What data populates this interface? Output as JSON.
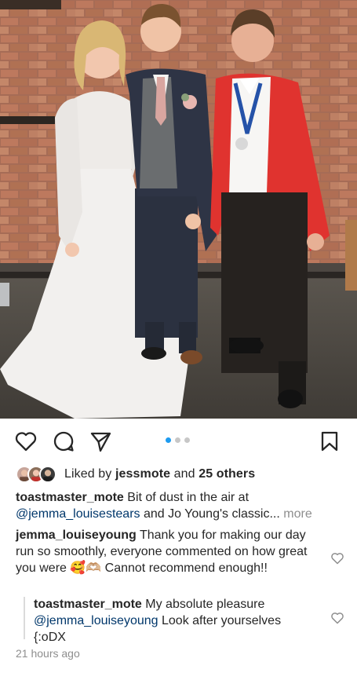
{
  "post": {
    "photo_icon": "wedding-photo",
    "carousel_total": 3,
    "carousel_active": 1
  },
  "actions": {
    "like_icon": "heart-icon",
    "comment_icon": "comment-bubble-icon",
    "share_icon": "paper-plane-icon",
    "save_icon": "bookmark-icon"
  },
  "likes": {
    "prefix": "Liked by ",
    "user": "jessmote",
    "joiner": " and ",
    "others": "25 others"
  },
  "caption": {
    "username": "toastmaster_mote",
    "text_before": " Bit of dust in the air at ",
    "mention": "@jemma_louisestears",
    "text_after": " and Jo Young's classic...",
    "more_label": " more"
  },
  "comments": [
    {
      "username": "jemma_louiseyoung",
      "text": " Thank you for making our day run so smoothly, everyone commented on how great you were 🥰🫶🏼 Cannot recommend enough!!"
    },
    {
      "username": "toastmaster_mote",
      "text_before": " My absolute pleasure ",
      "mention": "@jemma_louiseyoung",
      "text_after": " Look after yourselves {:oDX"
    }
  ],
  "timestamp": "21 hours ago",
  "colors": {
    "link": "#00376b",
    "muted": "#8e8e8e",
    "carousel_active": "#1d9bf0"
  }
}
